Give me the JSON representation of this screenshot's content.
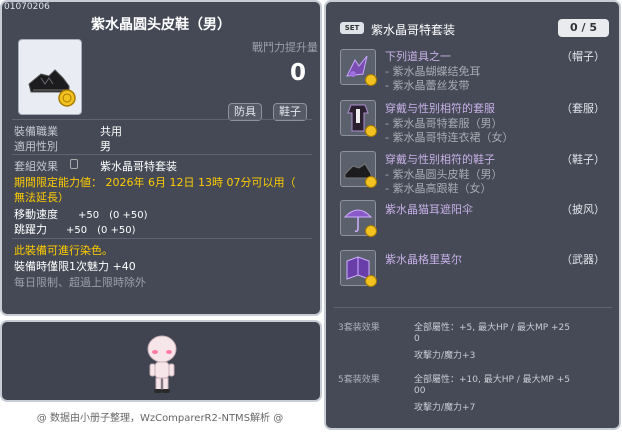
{
  "item": {
    "id": "01070206",
    "name": "紫水晶圆头皮鞋（男）",
    "attack_label": "戰鬥力提升量",
    "attack_value": "0",
    "tags": [
      "防具",
      "鞋子"
    ],
    "job_label": "裝備職業",
    "job_value": "共用",
    "gender_label": "適用性別",
    "gender_value": "男",
    "set_label": "套組效果",
    "set_value": "紫水晶哥特套装",
    "period_line1": "期間限定能力値：  2026年  6月  12日  13時  07分可以用（",
    "period_line2": "無法延長）",
    "speed_label": "移動速度",
    "speed_value": "+50　(0  +50)",
    "jump_label": "跳躍力",
    "jump_value": "+50　(0  +50)",
    "dye_note": "此裝備可進行染色。",
    "charm_line": "裝備時僅限1次魅力  +40",
    "limit_line": "每日限制、超過上限時除外"
  },
  "set_panel": {
    "badge": "SET",
    "title": "紫水晶哥特套装",
    "count": "0 / 5",
    "items": [
      {
        "lines": [
          "下列道具之一",
          "- 紫水晶蝴蝶结免耳",
          "- 紫水晶蕾丝发带"
        ],
        "category": "（帽子）",
        "icon": "hat-icon"
      },
      {
        "lines": [
          "穿戴与性别相符的套服",
          "- 紫水晶哥特套服（男）",
          "- 紫水晶哥特连衣裙（女）"
        ],
        "category": "（套服）",
        "icon": "outfit-icon"
      },
      {
        "lines": [
          "穿戴与性别相符的鞋子",
          "- 紫水晶圆头皮鞋（男）",
          "- 紫水晶高跟鞋（女）"
        ],
        "category": "（鞋子）",
        "icon": "shoe-icon"
      },
      {
        "lines": [
          "紫水晶猫耳遮阳伞"
        ],
        "category": "（披风）",
        "icon": "parasol-icon"
      },
      {
        "lines": [
          "紫水晶格里莫尔"
        ],
        "category": "（武器）",
        "icon": "grimoire-icon"
      }
    ],
    "effects": [
      {
        "label": "3套装效果",
        "line1": "全部屬性：+5,  最大HP / 最大MP   +25",
        "line2": "0",
        "line3": "攻擊力/魔力+3"
      },
      {
        "label": "5套装效果",
        "line1": "全部屬性：+10,  最大HP / 最大MP   +5",
        "line2": "00",
        "line3": "攻擊力/魔力+7"
      }
    ]
  },
  "footer": "@ 数据由小册子整理，WzComparerR2-NTMS解析 @",
  "colors": {
    "panel": "#444955",
    "accent_yellow": "#ffcc00",
    "accent_orange": "#ffaa33"
  }
}
